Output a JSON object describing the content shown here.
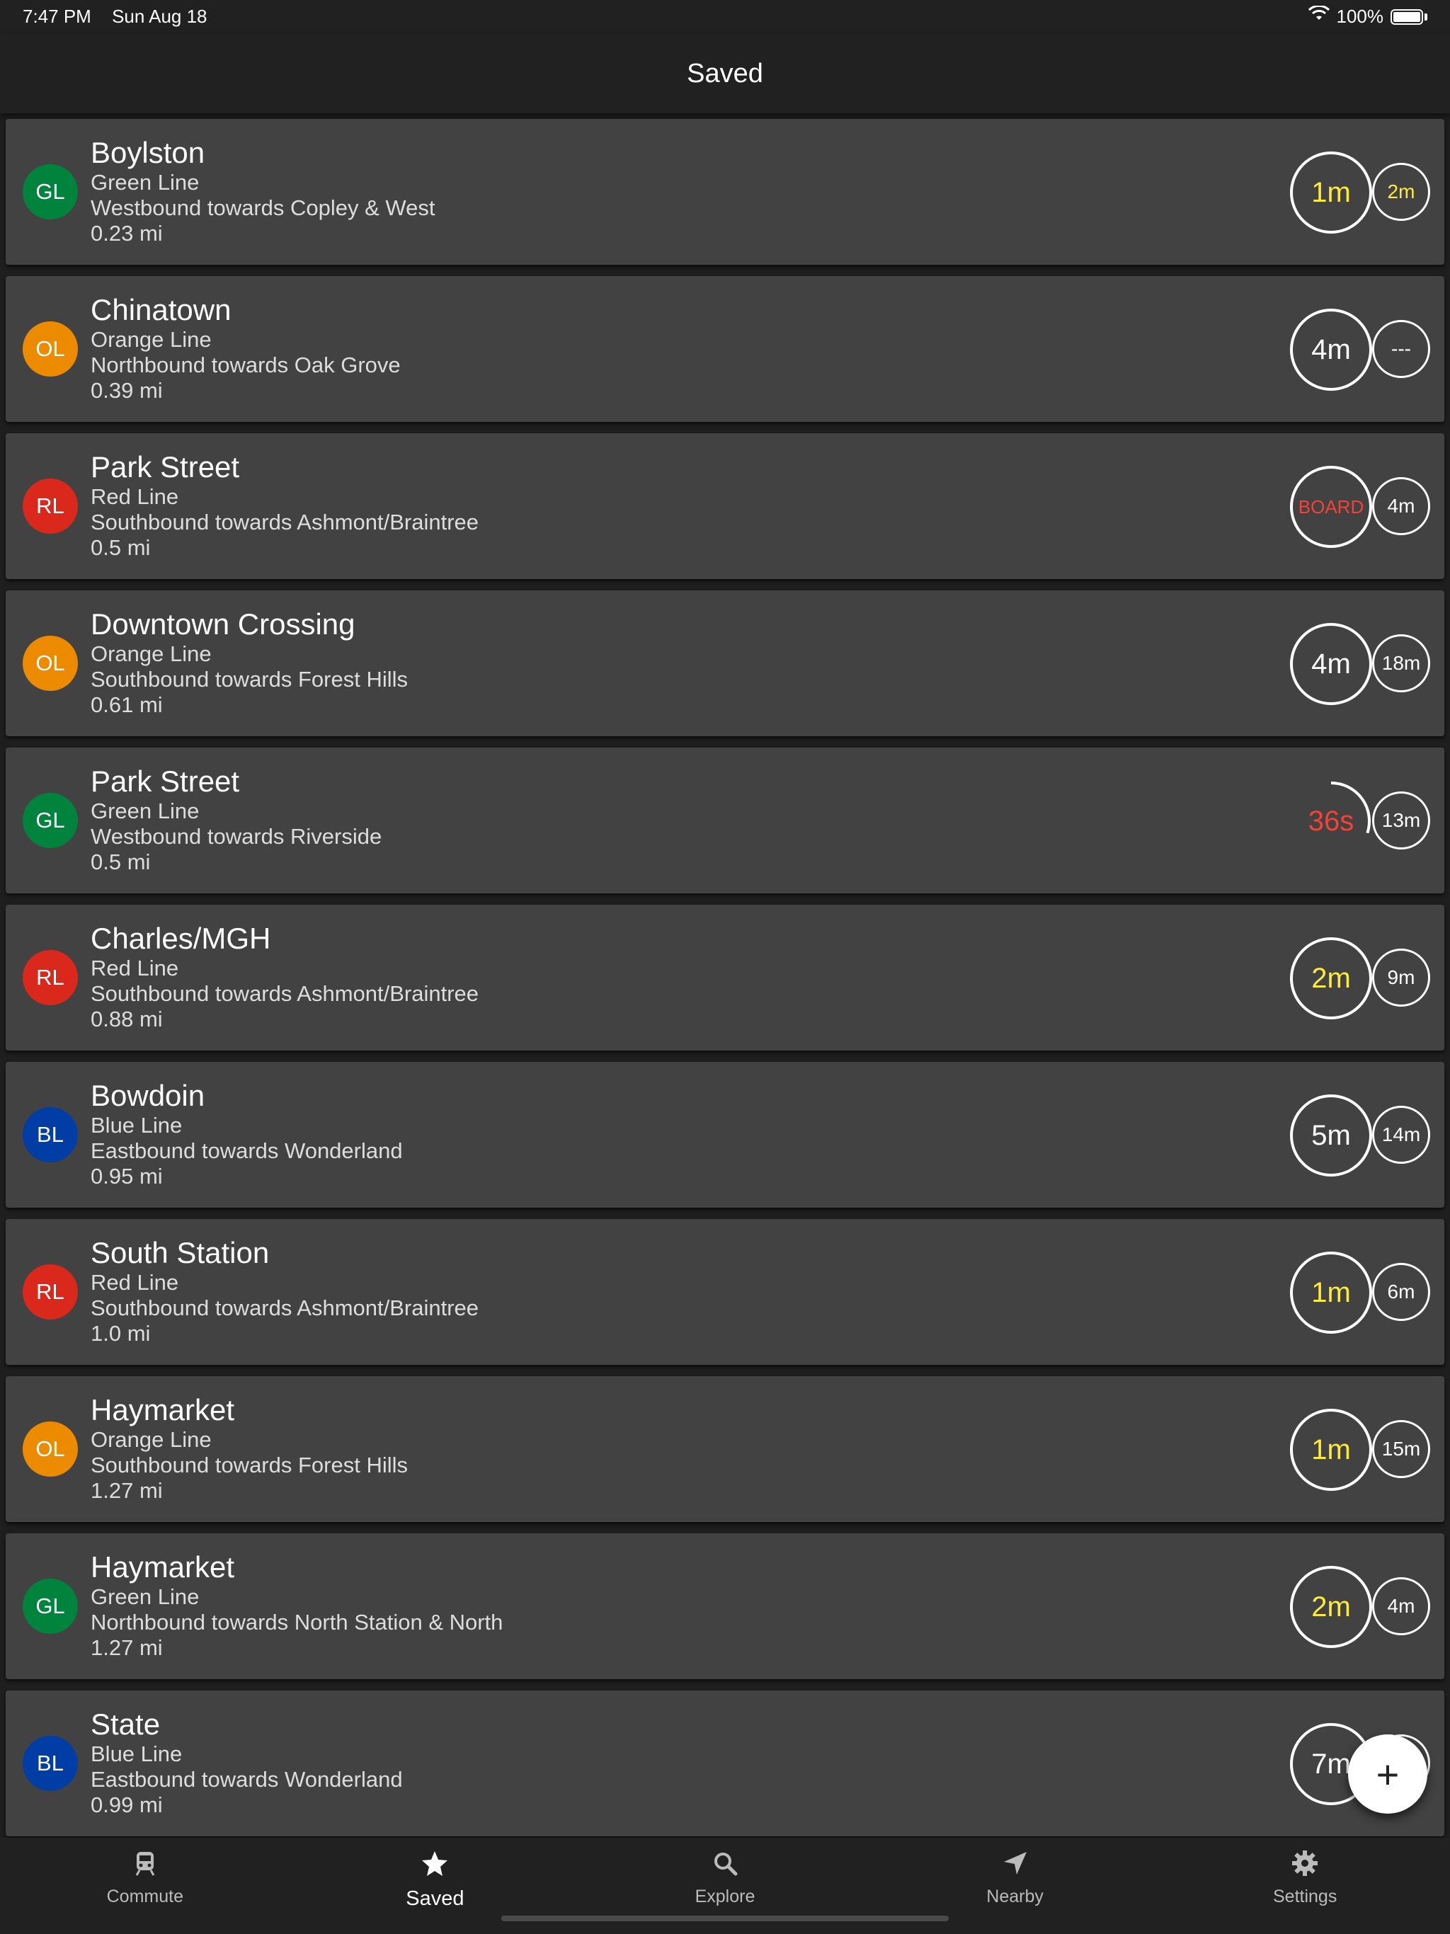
{
  "status": {
    "time": "7:47 PM",
    "date": "Sun Aug 18",
    "battery": "100%"
  },
  "header": {
    "title": "Saved"
  },
  "colors": {
    "GL": "#00843d",
    "OL": "#ed8b00",
    "RL": "#da291c",
    "BL": "#003da5",
    "yellow": "#ffeb3b",
    "red": "#f44336"
  },
  "stops": [
    {
      "badge": "GL",
      "name": "Boylston",
      "line": "Green Line",
      "direction": "Westbound towards Copley & West",
      "distance": "0.23 mi",
      "next": "1m",
      "next_color": "#ffeb3b",
      "after": "2m",
      "after_color": "#ffeb3b",
      "style": "circle"
    },
    {
      "badge": "OL",
      "name": "Chinatown",
      "line": "Orange Line",
      "direction": "Northbound towards Oak Grove",
      "distance": "0.39 mi",
      "next": "4m",
      "next_color": "#ffffff",
      "after": "---",
      "after_color": "#ffffff",
      "style": "circle"
    },
    {
      "badge": "RL",
      "name": "Park Street",
      "line": "Red Line",
      "direction": "Southbound towards Ashmont/Braintree",
      "distance": "0.5 mi",
      "next": "BOARD",
      "next_color": "#f44336",
      "after": "4m",
      "after_color": "#ffffff",
      "style": "circle"
    },
    {
      "badge": "OL",
      "name": "Downtown Crossing",
      "line": "Orange Line",
      "direction": "Southbound towards Forest Hills",
      "distance": "0.61 mi",
      "next": "4m",
      "next_color": "#ffffff",
      "after": "18m",
      "after_color": "#ffffff",
      "style": "circle"
    },
    {
      "badge": "GL",
      "name": "Park Street",
      "line": "Green Line",
      "direction": "Westbound towards Riverside",
      "distance": "0.5 mi",
      "next": "36s",
      "next_color": "#f44336",
      "after": "13m",
      "after_color": "#ffffff",
      "style": "arc",
      "progress": 0.3
    },
    {
      "badge": "RL",
      "name": "Charles/MGH",
      "line": "Red Line",
      "direction": "Southbound towards Ashmont/Braintree",
      "distance": "0.88 mi",
      "next": "2m",
      "next_color": "#ffeb3b",
      "after": "9m",
      "after_color": "#ffffff",
      "style": "circle"
    },
    {
      "badge": "BL",
      "name": "Bowdoin",
      "line": "Blue Line",
      "direction": "Eastbound towards Wonderland",
      "distance": "0.95 mi",
      "next": "5m",
      "next_color": "#ffffff",
      "after": "14m",
      "after_color": "#ffffff",
      "style": "circle"
    },
    {
      "badge": "RL",
      "name": "South Station",
      "line": "Red Line",
      "direction": "Southbound towards Ashmont/Braintree",
      "distance": "1.0 mi",
      "next": "1m",
      "next_color": "#ffeb3b",
      "after": "6m",
      "after_color": "#ffffff",
      "style": "circle"
    },
    {
      "badge": "OL",
      "name": "Haymarket",
      "line": "Orange Line",
      "direction": "Southbound towards Forest Hills",
      "distance": "1.27 mi",
      "next": "1m",
      "next_color": "#ffeb3b",
      "after": "15m",
      "after_color": "#ffffff",
      "style": "circle"
    },
    {
      "badge": "GL",
      "name": "Haymarket",
      "line": "Green Line",
      "direction": "Northbound towards North Station & North",
      "distance": "1.27 mi",
      "next": "2m",
      "next_color": "#ffeb3b",
      "after": "4m",
      "after_color": "#ffffff",
      "style": "circle"
    },
    {
      "badge": "BL",
      "name": "State",
      "line": "Blue Line",
      "direction": "Eastbound towards Wonderland",
      "distance": "0.99 mi",
      "next": "7m",
      "next_color": "#ffffff",
      "after": "",
      "after_color": "#ffffff",
      "style": "circle"
    }
  ],
  "fab": {
    "label": "+"
  },
  "tabs": [
    {
      "label": "Commute",
      "icon": "train-icon"
    },
    {
      "label": "Saved",
      "icon": "star-icon"
    },
    {
      "label": "Explore",
      "icon": "search-icon"
    },
    {
      "label": "Nearby",
      "icon": "location-arrow-icon"
    },
    {
      "label": "Settings",
      "icon": "gear-icon"
    }
  ],
  "active_tab": "Saved"
}
